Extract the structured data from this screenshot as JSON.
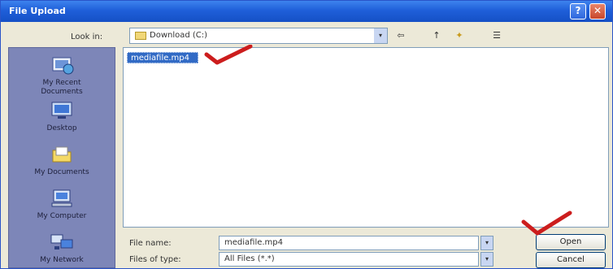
{
  "window": {
    "title": "File Upload"
  },
  "titlebar": {
    "help_glyph": "?",
    "close_glyph": "✕"
  },
  "toolbar": {
    "look_in_label": "Look in:",
    "look_in_value": "Download (C:)",
    "dropdown_glyph": "▾",
    "back_glyph": "⇦",
    "up_glyph": "↑",
    "newfolder_glyph": "✦",
    "views_glyph": "☰"
  },
  "places_bar": {
    "items": [
      {
        "label_line1": "My Recent",
        "label_line2": "Documents",
        "icon": "recent-documents-icon"
      },
      {
        "label_line1": "Desktop",
        "label_line2": "",
        "icon": "desktop-icon"
      },
      {
        "label_line1": "My Documents",
        "label_line2": "",
        "icon": "my-documents-icon"
      },
      {
        "label_line1": "My Computer",
        "label_line2": "",
        "icon": "my-computer-icon"
      },
      {
        "label_line1": "My Network",
        "label_line2": "",
        "icon": "my-network-icon"
      }
    ]
  },
  "file_list": {
    "items": [
      {
        "name": "mediafile.mp4",
        "selected": true
      }
    ]
  },
  "file_name": {
    "label": "File name:",
    "value": "mediafile.mp4"
  },
  "file_type": {
    "label": "Files of type:",
    "value": "All Files (*.*)"
  },
  "buttons": {
    "open": "Open",
    "cancel": "Cancel"
  },
  "colors": {
    "titlebar": "#1f5fd9",
    "dialog_bg": "#ece9d8",
    "places_bg": "#7d86b8",
    "selection": "#316ac5",
    "annotation_tick": "#cc1d1d"
  }
}
